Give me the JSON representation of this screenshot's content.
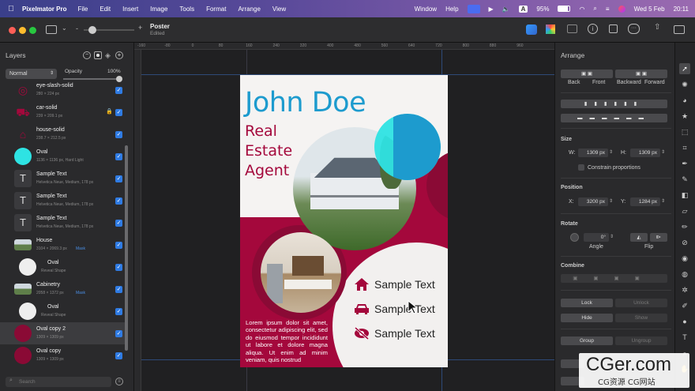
{
  "menubar": {
    "app": "Pixelmator Pro",
    "items": [
      "File",
      "Edit",
      "Insert",
      "Image",
      "Tools",
      "Format",
      "Arrange",
      "View"
    ],
    "right": [
      "Window",
      "Help"
    ],
    "battery": "95%",
    "date": "Wed 5 Feb",
    "time": "20:11"
  },
  "document": {
    "title": "Poster",
    "status": "Edited"
  },
  "layers": {
    "title": "Layers",
    "blend": "Normal",
    "opacity_label": "Opacity",
    "opacity": "100%",
    "search_placeholder": "Search",
    "items": [
      {
        "name": "eye-slash-solid",
        "sub": "280 × 224 px",
        "color": "#a4083c",
        "icon": "eye-slash-icon"
      },
      {
        "name": "car-solid",
        "sub": "239 × 209.1 px",
        "color": "#a4083c",
        "icon": "car-icon"
      },
      {
        "name": "house-solid",
        "sub": "238.7 × 212.5 px",
        "color": "#a4083c",
        "icon": "house-icon"
      },
      {
        "name": "Oval",
        "sub": "1136 × 1136 px, Hard Light",
        "color": "#2ee3e3",
        "icon": "oval-icon"
      },
      {
        "name": "Sample Text",
        "sub": "Helvetica Neue, Medium, 178 px",
        "icon": "text-icon"
      },
      {
        "name": "Sample Text",
        "sub": "Helvetica Neue, Medium, 178 px",
        "icon": "text-icon"
      },
      {
        "name": "Sample Text",
        "sub": "Helvetica Neue, Medium, 178 px",
        "icon": "text-icon"
      },
      {
        "name": "House",
        "sub": "3104 × 2069.3 px",
        "mask": "Mask",
        "icon": "photo-icon"
      },
      {
        "name": "Oval",
        "sub": "Reveal Shape",
        "icon": "oval-icon",
        "child": true
      },
      {
        "name": "Cabinetry",
        "sub": "2058 × 1372 px",
        "mask": "Mask",
        "icon": "photo-icon"
      },
      {
        "name": "Oval",
        "sub": "Reveal Shape",
        "icon": "oval-icon",
        "child": true
      },
      {
        "name": "Oval copy 2",
        "sub": "1309 × 1309 px",
        "color": "#8a0a35",
        "icon": "oval-icon",
        "selected": true
      },
      {
        "name": "Oval copy",
        "sub": "1309 × 1309 px",
        "color": "#8a0a35",
        "icon": "oval-icon"
      }
    ]
  },
  "ruler": [
    "-160",
    "-80",
    "0",
    "80",
    "160",
    "240",
    "320",
    "400",
    "480",
    "560",
    "640",
    "720",
    "800",
    "880",
    "960"
  ],
  "poster": {
    "name": "John Doe",
    "role": [
      "Real",
      "Estate",
      "Agent"
    ],
    "items": [
      "Sample Text",
      "Sample Text",
      "Sample Text"
    ],
    "body": "Lorem ipsum dolor sit amet, consectetur adipiscing elit, sed do eiusmod tempor incididunt ut labore et dolore magna aliqua. Ut enim ad minim veniam, quis nostrud",
    "maroon": "#a4083c",
    "blue": "#1d9bce",
    "cyan": "#2ee3e3"
  },
  "arrange": {
    "title": "Arrange",
    "order": [
      "Back",
      "Front",
      "Backward",
      "Forward"
    ],
    "size_label": "Size",
    "w_label": "W:",
    "w": "1309 px",
    "h_label": "H:",
    "h": "1309 px",
    "constrain": "Constrain proportions",
    "position_label": "Position",
    "x_label": "X:",
    "x": "3200 px",
    "y_label": "Y:",
    "y": "1284 px",
    "rotate_label": "Rotate",
    "angle": "0°",
    "angle_label": "Angle",
    "flip_label": "Flip",
    "combine_label": "Combine",
    "lock": "Lock",
    "unlock": "Unlock",
    "hide": "Hide",
    "show": "Show",
    "group": "Group",
    "ungroup": "Ungroup"
  },
  "watermark": {
    "main": "CGer.com",
    "sub": "CG资源 CG网站"
  }
}
